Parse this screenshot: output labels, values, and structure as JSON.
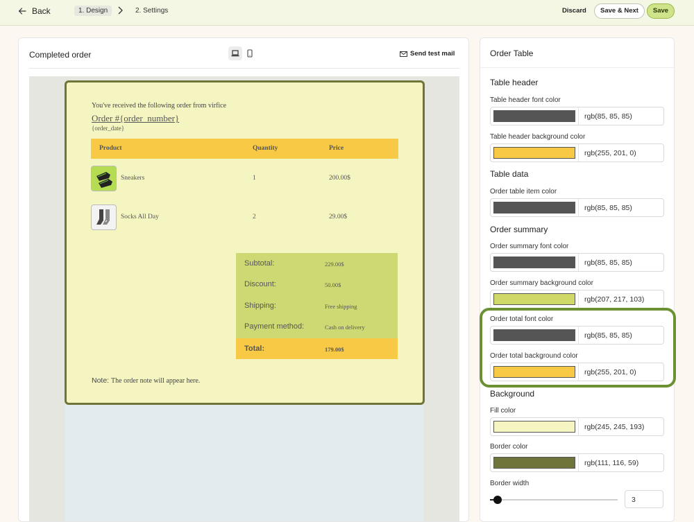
{
  "topbar": {
    "back_label": "Back",
    "step1": "1. Design",
    "step2": "2. Settings",
    "discard": "Discard",
    "save_next": "Save & Next",
    "save": "Save"
  },
  "preview": {
    "title": "Completed order",
    "send_test": "Send test mail",
    "icons": [
      "arrow-left-icon",
      "chevron-right-icon",
      "laptop-icon",
      "mobile-icon",
      "mail-icon"
    ]
  },
  "email": {
    "intro": "You've received the following order from virfice",
    "order_number": "Order #{order_number}",
    "order_date": "{order_date}",
    "headers": [
      "Product",
      "Quantity",
      "Price"
    ],
    "items": [
      {
        "name": "Sneakers",
        "qty": "1",
        "price": "200.00$"
      },
      {
        "name": "Socks All Day",
        "qty": "2",
        "price": "29.00$"
      }
    ],
    "summary": [
      {
        "label": "Subtotal:",
        "value": "229.00$"
      },
      {
        "label": "Discount:",
        "value": "50.00$"
      },
      {
        "label": "Shipping:",
        "value": "Free shipping"
      },
      {
        "label": "Payment method:",
        "value": "Cash on delivery"
      }
    ],
    "total_label": "Total:",
    "total_value": "179.00$",
    "note_label": "Note:",
    "note_value": "The order note will appear here."
  },
  "panel": {
    "title": "Order Table",
    "sections": {
      "table_header": "Table header",
      "table_data": "Table data",
      "order_summary": "Order summary",
      "background": "Background"
    },
    "fields": {
      "header_font": {
        "label": "Table header font color",
        "value": "rgb(85, 85, 85)",
        "color": "#555555"
      },
      "header_bg": {
        "label": "Table header background color",
        "value": "rgb(255, 201, 0)",
        "color": "#f7c944"
      },
      "item_color": {
        "label": "Order table item color",
        "value": "rgb(85, 85, 85)",
        "color": "#555555"
      },
      "summary_font": {
        "label": "Order summary font color",
        "value": "rgb(85, 85, 85)",
        "color": "#555555"
      },
      "summary_bg": {
        "label": "Order summary background color",
        "value": "rgb(207, 217, 103)",
        "color": "#cfd967"
      },
      "total_font": {
        "label": "Order total font color",
        "value": "rgb(85, 85, 85)",
        "color": "#555555"
      },
      "total_bg": {
        "label": "Order total background color",
        "value": "rgb(255, 201, 0)",
        "color": "#f7c944"
      },
      "fill": {
        "label": "Fill color",
        "value": "rgb(245, 245, 193)",
        "color": "#f5f5c1"
      },
      "border_color": {
        "label": "Border color",
        "value": "rgb(111, 116, 59)",
        "color": "#6f743b"
      }
    },
    "border_width_label": "Border width",
    "border_width_value": "3",
    "border_width_max": 50
  }
}
